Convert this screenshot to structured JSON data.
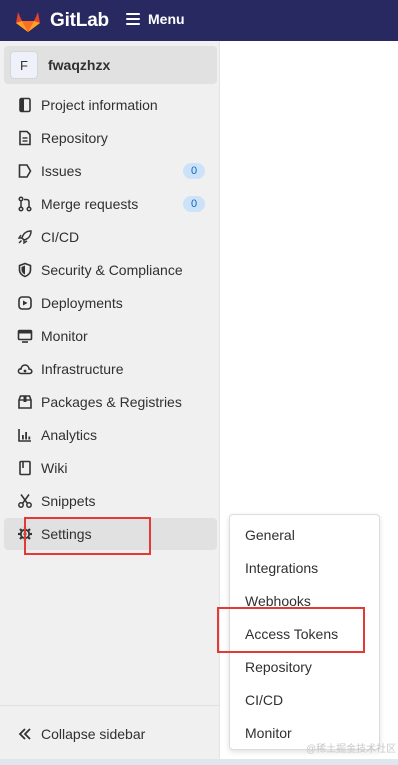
{
  "topbar": {
    "brand": "GitLab",
    "menu_label": "Menu",
    "logo_icon": "gitlab-tanuki-icon",
    "menu_icon": "hamburger-icon"
  },
  "project": {
    "avatar_letter": "F",
    "name": "fwaqzhzx"
  },
  "nav": [
    {
      "label": "Project information",
      "icon": "project-info-icon"
    },
    {
      "label": "Repository",
      "icon": "document-icon"
    },
    {
      "label": "Issues",
      "icon": "issues-icon",
      "badge": "0"
    },
    {
      "label": "Merge requests",
      "icon": "merge-request-icon",
      "badge": "0"
    },
    {
      "label": "CI/CD",
      "icon": "rocket-icon"
    },
    {
      "label": "Security & Compliance",
      "icon": "shield-icon"
    },
    {
      "label": "Deployments",
      "icon": "deployments-icon"
    },
    {
      "label": "Monitor",
      "icon": "monitor-icon"
    },
    {
      "label": "Infrastructure",
      "icon": "cloud-icon"
    },
    {
      "label": "Packages & Registries",
      "icon": "package-icon"
    },
    {
      "label": "Analytics",
      "icon": "chart-icon"
    },
    {
      "label": "Wiki",
      "icon": "book-icon"
    },
    {
      "label": "Snippets",
      "icon": "scissors-icon"
    },
    {
      "label": "Settings",
      "icon": "gear-icon",
      "active": true
    }
  ],
  "collapse_label": "Collapse sidebar",
  "settings_flyout": [
    "General",
    "Integrations",
    "Webhooks",
    "Access Tokens",
    "Repository",
    "CI/CD",
    "Monitor"
  ],
  "watermark": "@稀土掘金技术社区",
  "colors": {
    "topbar": "#292961",
    "sidebar": "#f0f0f0",
    "highlight": "#e53935",
    "badge_bg": "#cbe2f9",
    "badge_text": "#1068bf"
  }
}
